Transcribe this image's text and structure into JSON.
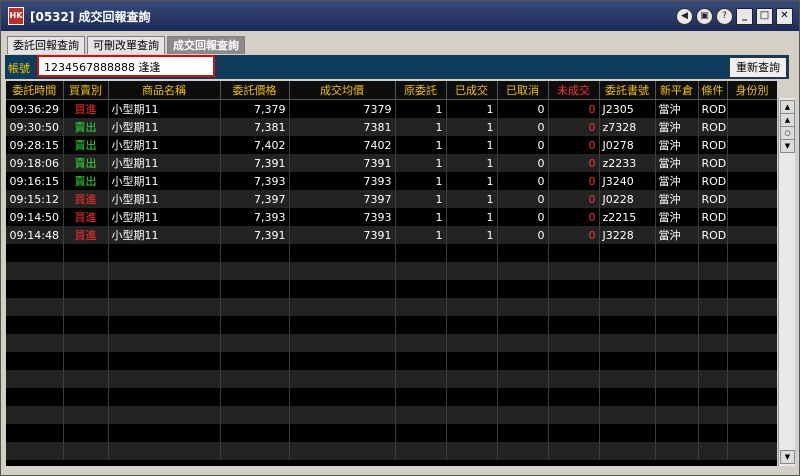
{
  "window": {
    "title": "[0532] 成交回報查詢",
    "icon_text": "HK"
  },
  "tabs": [
    {
      "label": "委託回報查詢",
      "active": false
    },
    {
      "label": "可刪改單查詢",
      "active": false
    },
    {
      "label": "成交回報查詢",
      "active": true
    }
  ],
  "account": {
    "label": "帳號",
    "value": "1234567888888  逢逢"
  },
  "toolbar": {
    "refresh_label": "重新查詢"
  },
  "table": {
    "columns": [
      "委託時間",
      "買賣別",
      "商品名稱",
      "委託價格",
      "成交均價",
      "原委託",
      "已成交",
      "已取消",
      "未成交",
      "委託書號",
      "新平倉",
      "條件",
      "身份別"
    ],
    "rows": [
      {
        "time": "09:36:29",
        "side": "買進",
        "product": "小型期11",
        "order_price": "7,379",
        "avg_price": "7379",
        "orig": "1",
        "filled": "1",
        "cancelled": "0",
        "unfilled": "0",
        "order_no": "J2305",
        "position": "當沖",
        "cond": "ROD",
        "identity": ""
      },
      {
        "time": "09:30:50",
        "side": "賣出",
        "product": "小型期11",
        "order_price": "7,381",
        "avg_price": "7381",
        "orig": "1",
        "filled": "1",
        "cancelled": "0",
        "unfilled": "0",
        "order_no": "z7328",
        "position": "當沖",
        "cond": "ROD",
        "identity": ""
      },
      {
        "time": "09:28:15",
        "side": "賣出",
        "product": "小型期11",
        "order_price": "7,402",
        "avg_price": "7402",
        "orig": "1",
        "filled": "1",
        "cancelled": "0",
        "unfilled": "0",
        "order_no": "J0278",
        "position": "當沖",
        "cond": "ROD",
        "identity": ""
      },
      {
        "time": "09:18:06",
        "side": "賣出",
        "product": "小型期11",
        "order_price": "7,391",
        "avg_price": "7391",
        "orig": "1",
        "filled": "1",
        "cancelled": "0",
        "unfilled": "0",
        "order_no": "z2233",
        "position": "當沖",
        "cond": "ROD",
        "identity": ""
      },
      {
        "time": "09:16:15",
        "side": "賣出",
        "product": "小型期11",
        "order_price": "7,393",
        "avg_price": "7393",
        "orig": "1",
        "filled": "1",
        "cancelled": "0",
        "unfilled": "0",
        "order_no": "J3240",
        "position": "當沖",
        "cond": "ROD",
        "identity": ""
      },
      {
        "time": "09:15:12",
        "side": "買進",
        "product": "小型期11",
        "order_price": "7,397",
        "avg_price": "7397",
        "orig": "1",
        "filled": "1",
        "cancelled": "0",
        "unfilled": "0",
        "order_no": "J0228",
        "position": "當沖",
        "cond": "ROD",
        "identity": ""
      },
      {
        "time": "09:14:50",
        "side": "買進",
        "product": "小型期11",
        "order_price": "7,393",
        "avg_price": "7393",
        "orig": "1",
        "filled": "1",
        "cancelled": "0",
        "unfilled": "0",
        "order_no": "z2215",
        "position": "當沖",
        "cond": "ROD",
        "identity": ""
      },
      {
        "time": "09:14:48",
        "side": "買進",
        "product": "小型期11",
        "order_price": "7,391",
        "avg_price": "7391",
        "orig": "1",
        "filled": "1",
        "cancelled": "0",
        "unfilled": "0",
        "order_no": "J3228",
        "position": "當沖",
        "cond": "ROD",
        "identity": ""
      }
    ]
  },
  "colors": {
    "buy": "#ff3030",
    "sell": "#30e030",
    "header": "#f0c000",
    "unfilled_header": "#ff3030"
  }
}
